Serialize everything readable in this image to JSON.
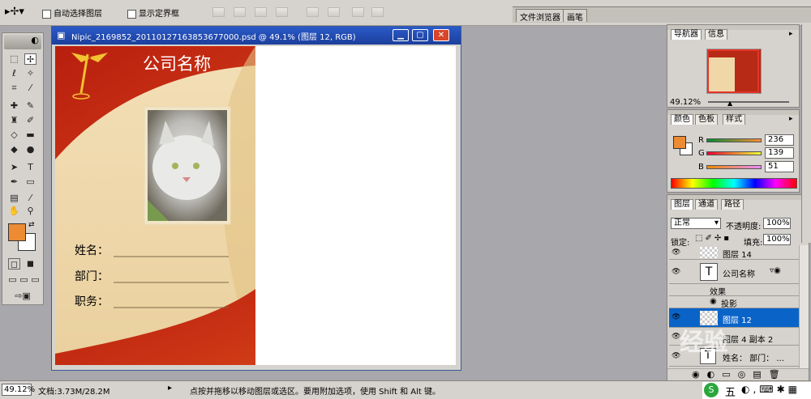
{
  "options_bar": {
    "auto_select_label": "自动选择图层",
    "show_bounds_label": "显示定界框"
  },
  "palette_well": {
    "tabs": [
      "文件浏览器",
      "画笔"
    ]
  },
  "document": {
    "title": "Nipic_2169852_20110127163853677000.psd @ 49.1% (图层 12, RGB)",
    "card": {
      "company": "公司名称",
      "fields": [
        "姓名：",
        "部门：",
        "职务："
      ]
    }
  },
  "navigator": {
    "tabs": [
      "导航器",
      "信息"
    ],
    "zoom": "49.12%"
  },
  "color_panel": {
    "tabs": [
      "颜色",
      "色板",
      "样式"
    ],
    "r_label": "R",
    "g_label": "G",
    "b_label": "B",
    "r": "236",
    "g": "139",
    "b": "51",
    "fg_color": "#ec8b33"
  },
  "layers_panel": {
    "tabs": [
      "图层",
      "通道",
      "路径"
    ],
    "blend_mode": "正常",
    "opacity_label": "不透明度:",
    "opacity": "100%",
    "lock_label": "锁定:",
    "fill_label": "填充:",
    "fill": "100%",
    "layers": [
      {
        "name": "图层 14"
      },
      {
        "name": "公司名称",
        "type_glyph": "T"
      },
      {
        "name": "效果"
      },
      {
        "name": "投影"
      },
      {
        "name": "图层 12"
      },
      {
        "name": "图层 4 副本 2"
      },
      {
        "name": "姓名：  部门：  ..."
      }
    ]
  },
  "status_bar": {
    "zoom": "49.12%",
    "doc_info": "文档:3.73M/28.2M",
    "hint": "点按并拖移以移动图层或选区。要用附加选项，使用 Shift 和 Alt 键。"
  },
  "taskbar": {
    "ime_label": "五"
  },
  "watermark": {
    "text": "经验"
  }
}
